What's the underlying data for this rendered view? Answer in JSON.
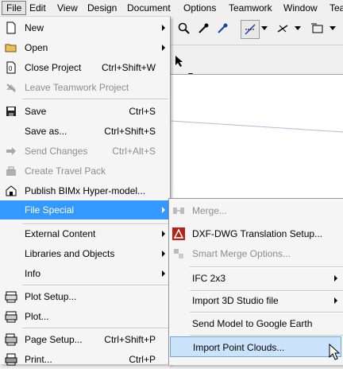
{
  "menubar": {
    "items": [
      "File",
      "Edit",
      "View",
      "Design",
      "Document",
      "Options",
      "Teamwork",
      "Window",
      "Tea"
    ]
  },
  "file_menu": {
    "items": [
      {
        "label": "New",
        "shortcut": "",
        "submenu": true,
        "disabled": false,
        "icon": "new-document-icon"
      },
      {
        "label": "Open",
        "shortcut": "",
        "submenu": true,
        "disabled": false,
        "icon": "open-folder-icon"
      },
      {
        "label": "Close Project",
        "shortcut": "Ctrl+Shift+W",
        "submenu": false,
        "disabled": false,
        "icon": "close-project-icon"
      },
      {
        "label": "Leave Teamwork Project",
        "shortcut": "",
        "submenu": false,
        "disabled": true,
        "icon": "leave-teamwork-icon"
      },
      {
        "label": "Save",
        "shortcut": "Ctrl+S",
        "submenu": false,
        "disabled": false,
        "icon": "save-icon"
      },
      {
        "label": "Save as...",
        "shortcut": "Ctrl+Shift+S",
        "submenu": false,
        "disabled": false,
        "icon": ""
      },
      {
        "label": "Send Changes",
        "shortcut": "Ctrl+Alt+S",
        "submenu": false,
        "disabled": true,
        "icon": "send-changes-icon"
      },
      {
        "label": "Create Travel Pack",
        "shortcut": "",
        "submenu": false,
        "disabled": true,
        "icon": "travel-pack-icon"
      },
      {
        "label": "Publish BIMx Hyper-model...",
        "shortcut": "",
        "submenu": false,
        "disabled": false,
        "icon": "bimx-icon"
      },
      {
        "label": "File Special",
        "shortcut": "",
        "submenu": true,
        "disabled": false,
        "icon": ""
      },
      {
        "label": "External Content",
        "shortcut": "",
        "submenu": true,
        "disabled": false,
        "icon": ""
      },
      {
        "label": "Libraries and Objects",
        "shortcut": "",
        "submenu": true,
        "disabled": false,
        "icon": ""
      },
      {
        "label": "Info",
        "shortcut": "",
        "submenu": true,
        "disabled": false,
        "icon": ""
      },
      {
        "label": "Plot Setup...",
        "shortcut": "",
        "submenu": false,
        "disabled": false,
        "icon": "plot-setup-icon"
      },
      {
        "label": "Plot...",
        "shortcut": "",
        "submenu": false,
        "disabled": false,
        "icon": "plot-icon"
      },
      {
        "label": "Page Setup...",
        "shortcut": "Ctrl+Shift+P",
        "submenu": false,
        "disabled": false,
        "icon": "page-setup-icon"
      },
      {
        "label": "Print...",
        "shortcut": "Ctrl+P",
        "submenu": false,
        "disabled": false,
        "icon": "print-icon"
      }
    ]
  },
  "file_special_menu": {
    "items": [
      {
        "label": "Merge...",
        "disabled": true,
        "submenu": false,
        "icon": "merge-icon"
      },
      {
        "label": "DXF-DWG Translation Setup...",
        "disabled": false,
        "submenu": false,
        "icon": "dxf-dwg-icon"
      },
      {
        "label": "Smart Merge Options...",
        "disabled": true,
        "submenu": false,
        "icon": "smart-merge-icon"
      },
      {
        "label": "IFC 2x3",
        "disabled": false,
        "submenu": true,
        "icon": ""
      },
      {
        "label": "Import 3D Studio file",
        "disabled": false,
        "submenu": true,
        "icon": ""
      },
      {
        "label": "Send Model to Google Earth",
        "disabled": false,
        "submenu": false,
        "icon": ""
      },
      {
        "label": "Import Point Clouds...",
        "disabled": false,
        "submenu": false,
        "icon": ""
      }
    ]
  },
  "colors": {
    "highlight": "#3399ff",
    "hover": "#cce4fb",
    "disabled": "#8d8d8d"
  }
}
